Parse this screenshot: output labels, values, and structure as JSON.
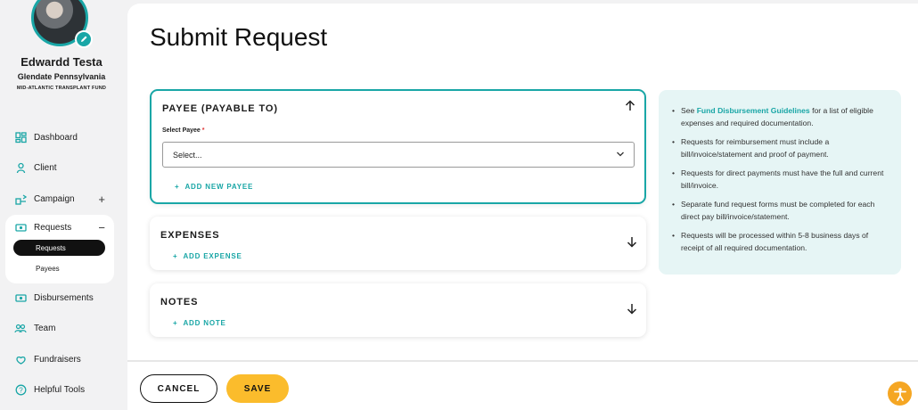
{
  "user": {
    "name": "Edwardd Testa",
    "location": "Glendate Pennsylvania",
    "org": "MID-ATLANTIC TRANSPLANT FUND"
  },
  "nav": {
    "dashboard": "Dashboard",
    "client": "Client",
    "campaign": "Campaign",
    "requests": "Requests",
    "sub_requests": "Requests",
    "sub_payees": "Payees",
    "disbursements": "Disbursements",
    "team": "Team",
    "fundraisers": "Fundraisers",
    "helpful_tools": "Helpful Tools"
  },
  "page": {
    "title": "Submit Request"
  },
  "payee": {
    "title": "PAYEE (PAYABLE TO)",
    "field_label": "Select Payee",
    "required_mark": "*",
    "select_value": "Select...",
    "add_label": "ADD NEW PAYEE"
  },
  "expenses": {
    "title": "EXPENSES",
    "add_label": "ADD EXPENSE"
  },
  "notes": {
    "title": "NOTES",
    "add_label": "ADD NOTE"
  },
  "info": {
    "b1_pre": "See ",
    "b1_link": "Fund Disbursement Guidelines",
    "b1_post": " for a list of eligible expenses and required documentation.",
    "b2": "Requests for reimbursement must include a bill/invoice/statement and proof of payment.",
    "b3": "Requests for direct payments must have the full and current bill/invoice.",
    "b4": "Separate fund request forms must be completed for each direct pay bill/invoice/statement.",
    "b5": "Requests will be processed within 5-8 business days of receipt of all required documentation."
  },
  "footer": {
    "cancel": "CANCEL",
    "save": "SAVE"
  },
  "colors": {
    "accent": "#19a6a6",
    "save": "#fbbc2c",
    "info_bg": "#e6f5f5",
    "accessibility": "#f5a623"
  },
  "icons": [
    "pencil-icon",
    "dashboard-icon",
    "client-icon",
    "campaign-icon",
    "requests-icon",
    "disbursements-icon",
    "team-icon",
    "fundraisers-icon",
    "help-icon",
    "chevron-up-icon",
    "chevron-down-icon",
    "accessibility-icon"
  ]
}
